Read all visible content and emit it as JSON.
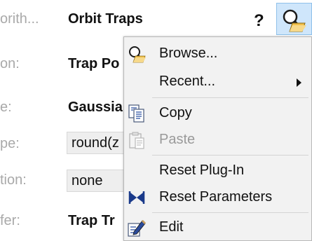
{
  "panel": {
    "rows": [
      {
        "label": "orith...",
        "value": "Orbit Traps"
      },
      {
        "label": "on:",
        "value": "Trap Po"
      },
      {
        "label": "e:",
        "value": "Gaussia"
      },
      {
        "label": "pe:",
        "value": "round(z"
      },
      {
        "label": "tion:",
        "value": "none"
      },
      {
        "label": "fer:",
        "value": "Trap Tr"
      }
    ],
    "help_label": "?",
    "menu_button_icon": "browse-icon"
  },
  "menu": {
    "items": [
      {
        "label": "Browse...",
        "icon": "browse-icon",
        "enabled": true
      },
      {
        "label": "Recent...",
        "has_submenu": true,
        "enabled": true
      },
      {
        "label": "Copy",
        "icon": "copy-icon",
        "enabled": true
      },
      {
        "label": "Paste",
        "icon": "paste-icon",
        "enabled": false
      },
      {
        "label": "Reset Plug-In",
        "enabled": true
      },
      {
        "label": "Reset Parameters",
        "icon": "reset-parameters-icon",
        "enabled": true
      },
      {
        "label": "Edit",
        "icon": "edit-icon",
        "enabled": true
      }
    ]
  },
  "colors": {
    "menu_background": "#f2f2f2",
    "button_highlight": "#cfe6fb",
    "label_gray": "#a9a9a9"
  }
}
